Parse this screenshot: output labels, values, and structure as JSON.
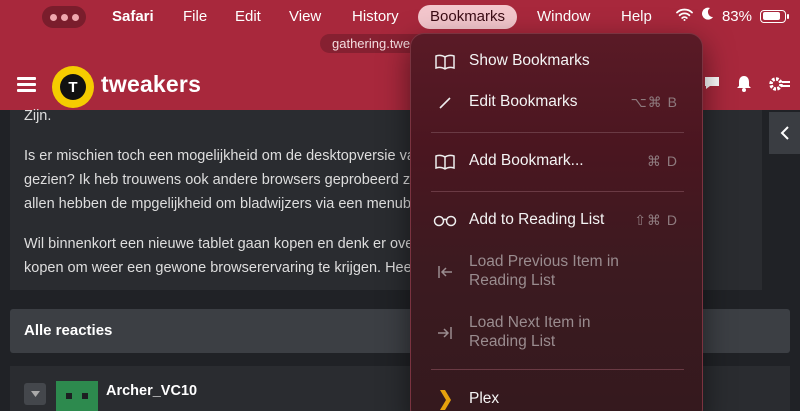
{
  "menubar": {
    "app_name": "Safari",
    "items": [
      "File",
      "Edit",
      "View",
      "History",
      "Bookmarks",
      "Window",
      "Help"
    ],
    "active_item": "Bookmarks",
    "battery_percent": "83%",
    "battery_level": 0.83
  },
  "browser": {
    "url_partial": "gathering.twe"
  },
  "site": {
    "logo_letter": "T",
    "logo_text": "tweakers"
  },
  "post": {
    "line_0": "Zijn.",
    "line_1": "Is er mischien toch een mogelijkheid om de desktopversie van",
    "line_2": "gezien? Ik heb trouwens ook andere browsers geprobeerd zoa",
    "line_3": "allen hebben de mpgelijkheid om bladwijzers via een menubalk",
    "line_4": "Wil binnenkort een nieuwe tablet gaan kopen en denk er over c",
    "line_5": "kopen om weer een gewone browserervaring te krijgen. Heeft i"
  },
  "reacties": {
    "title": "Alle reacties"
  },
  "comment": {
    "username": "Archer_VC10"
  },
  "bookmarks_menu": {
    "show_bookmarks": "Show Bookmarks",
    "edit_bookmarks": "Edit Bookmarks",
    "edit_bookmarks_shortcut": "⌥⌘ B",
    "add_bookmark": "Add Bookmark...",
    "add_bookmark_shortcut": "⌘ D",
    "add_reading_list": "Add to Reading List",
    "add_reading_list_shortcut": "⇧⌘ D",
    "load_previous_line1": "Load Previous Item in",
    "load_previous_line2": "Reading List",
    "load_next_line1": "Load Next Item in",
    "load_next_line2": "Reading List",
    "plex": "Plex"
  },
  "colors": {
    "brand_red": "#a8283c",
    "logo_yellow": "#f5cc00",
    "page_bg": "#202226"
  }
}
